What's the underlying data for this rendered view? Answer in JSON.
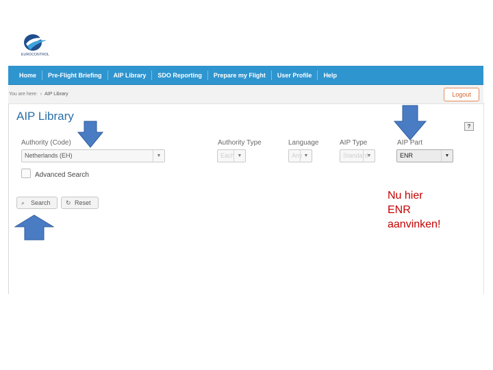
{
  "app": {
    "logo_text": "EUROCONTROL",
    "logo_icon": "eurocontrol-logo"
  },
  "nav": {
    "items": [
      {
        "label": "Home"
      },
      {
        "label": "Pre-Flight Briefing"
      },
      {
        "label": "AIP Library"
      },
      {
        "label": "SDO Reporting"
      },
      {
        "label": "Prepare my Flight"
      },
      {
        "label": "User Profile"
      },
      {
        "label": "Help"
      }
    ]
  },
  "breadcrumb": {
    "prefix": "You are here:",
    "current": "AIP Library"
  },
  "header": {
    "logout_label": "Logout",
    "help_label": "?"
  },
  "page": {
    "title": "AIP Library"
  },
  "form": {
    "authority": {
      "label": "Authority (Code)",
      "value": "Netherlands (EH)"
    },
    "authority_type": {
      "label": "Authority Type",
      "value": "Each"
    },
    "language": {
      "label": "Language",
      "value": "Any"
    },
    "aip_type": {
      "label": "AIP Type",
      "value": "Standard"
    },
    "aip_part": {
      "label": "AIP Part",
      "value": "ENR"
    },
    "advanced_search_label": "Advanced Search",
    "search_label": "Search",
    "reset_label": "Reset"
  },
  "annotation": {
    "note": "Nu hier\nENR\naanvinken!",
    "arrow_color": "#4a7cc4"
  },
  "colors": {
    "navbar": "#2f95cf",
    "title": "#2a6fa8",
    "logout": "#d4612a",
    "note": "#c40000"
  }
}
